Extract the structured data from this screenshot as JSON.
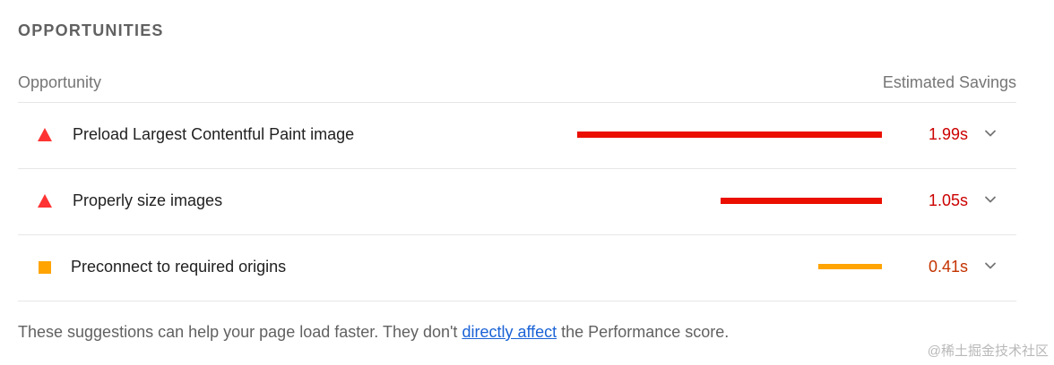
{
  "section": {
    "title": "OPPORTUNITIES"
  },
  "table": {
    "header": {
      "opportunity": "Opportunity",
      "savings": "Estimated Savings"
    },
    "rows": [
      {
        "label": "Preload Largest Contentful Paint image",
        "savings": "1.99s",
        "status": "fail",
        "icon": "red-triangle-icon",
        "bar_fraction": 1.0,
        "bar_color": "#eb0f00"
      },
      {
        "label": "Properly size images",
        "savings": "1.05s",
        "status": "fail",
        "icon": "red-triangle-icon",
        "bar_fraction": 0.53,
        "bar_color": "#eb0f00"
      },
      {
        "label": "Preconnect to required origins",
        "savings": "0.41s",
        "status": "average",
        "icon": "orange-square-icon",
        "bar_fraction": 0.21,
        "bar_color": "#ffa400"
      }
    ]
  },
  "footer": {
    "text_before": "These suggestions can help your page load faster. They don't ",
    "link_text": "directly affect",
    "text_after": " the Performance score."
  },
  "watermark": "@稀土掘金技术社区",
  "colors": {
    "fail": "#eb0f00",
    "average": "#ffa400",
    "link": "#1a62d6"
  }
}
